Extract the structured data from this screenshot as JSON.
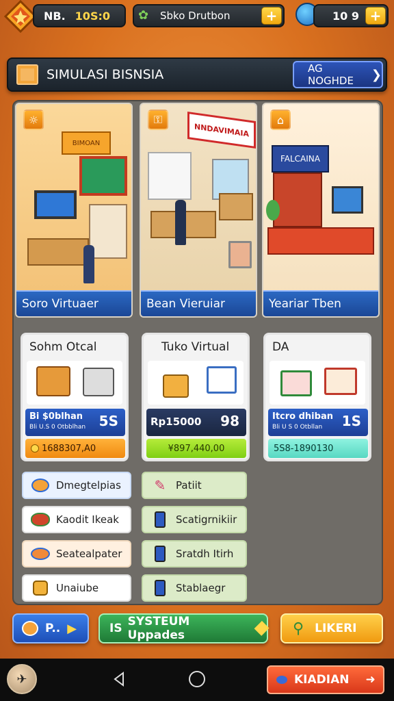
{
  "top_bar": {
    "level_label": "NB.",
    "level_value": "10S:0",
    "location": "Sbko Drutbon",
    "coins": "10 9",
    "plus": "+"
  },
  "title_bar": {
    "title": "SIMULASI BISNSIA",
    "button_label": "AG NOGHDE",
    "button_arrow": "❯"
  },
  "stores": [
    {
      "label": "Soro Virtuaer",
      "sign": "BIMOAN"
    },
    {
      "label": "Bean Vieruiar",
      "sign": "NNDAVIMAIA"
    },
    {
      "label": "Yeariar Tben",
      "sign": "FALCAINA"
    }
  ],
  "products": [
    {
      "title": "Sohm Otcal",
      "price": "Bi $0blhan",
      "sub": "Bli U.S 0 Otbblhan",
      "right": "5S",
      "value": "1688307,A0"
    },
    {
      "title": "Tuko Virtual",
      "price": "Rp15000",
      "sub": "",
      "right": "98",
      "value": "¥897,440,00"
    },
    {
      "title": "DA",
      "price": "Itcro dhiban",
      "sub": "Bli U S 0 Otbllan",
      "right": "1S",
      "value": "5S8-1890130"
    }
  ],
  "list_left": [
    {
      "label": "Dmegtelpias",
      "icon": "egg-icon"
    },
    {
      "label": "Kaodit Ikeak",
      "icon": "meat-icon"
    },
    {
      "label": "Seatealpater",
      "icon": "fish-icon"
    },
    {
      "label": "Unaiube",
      "icon": "bag-icon"
    }
  ],
  "list_right": [
    {
      "label": "Patiit",
      "icon": "pencil-icon"
    },
    {
      "label": "Scatigrnikiir",
      "icon": "can-icon"
    },
    {
      "label": "Sratdh Itirh",
      "icon": "can-icon"
    },
    {
      "label": "Stablaegr",
      "icon": "can-icon"
    }
  ],
  "bottom_buttons": {
    "left_label": "P..",
    "middle_label": "SYSTEUM Uppades",
    "middle_icon": "IS",
    "right_label": "LIKERI"
  },
  "nav": {
    "action_label": "KIADIAN"
  },
  "colors": {
    "accent_orange": "#f29a45",
    "store_label_blue": "#1b4796",
    "list_left_bg": "#eaf2ff",
    "list_right_bg": "#dcebc8",
    "green_button": "#2e9b4a",
    "yellow_button": "#f4b416",
    "red_button": "#e0461c"
  }
}
